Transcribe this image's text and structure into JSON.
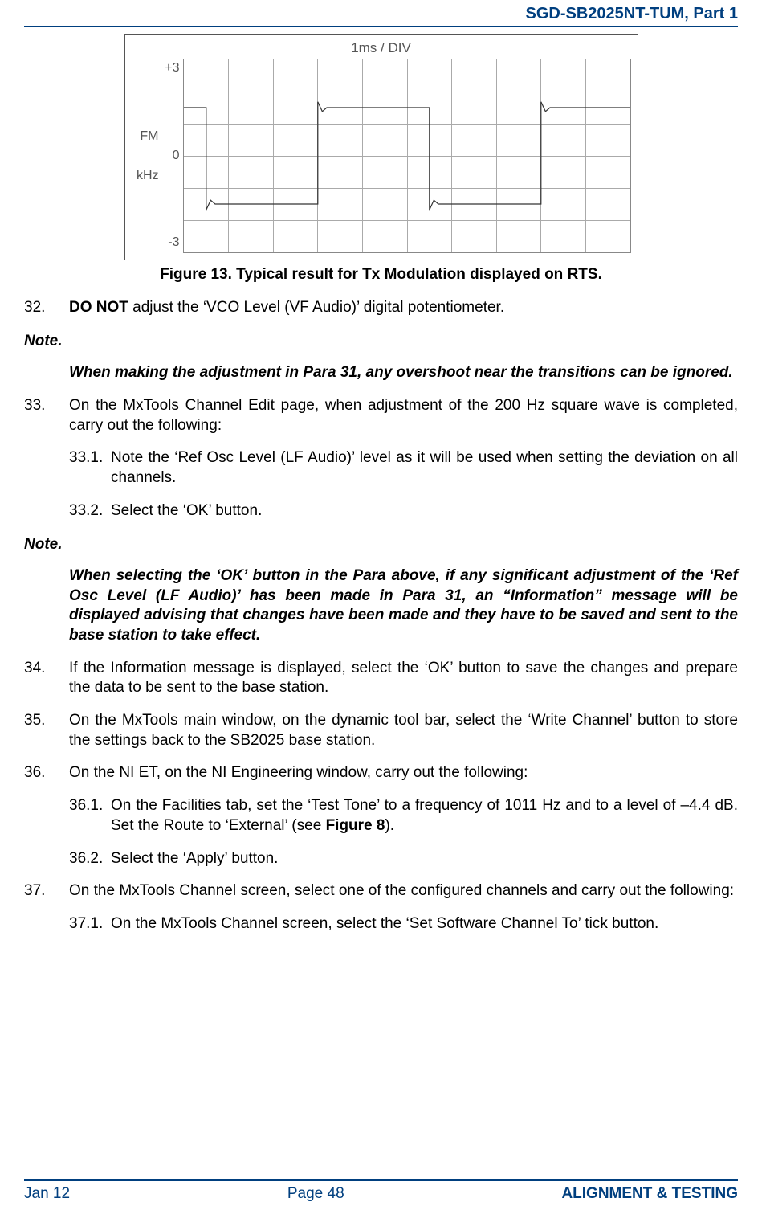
{
  "header": {
    "doc_id": "SGD-SB2025NT-TUM, Part 1"
  },
  "chart_data": {
    "type": "line",
    "title": "1ms / DIV",
    "xlabel": "",
    "ylabel_lines": [
      "FM",
      "kHz"
    ],
    "y_ticks": [
      "+3",
      "0",
      "-3"
    ],
    "ylim": [
      -3,
      3
    ],
    "x_divisions": 10,
    "note": "200 Hz square wave, approx -1.5 to +1.5 kHz deviation with slight overshoot at transitions"
  },
  "figure": {
    "caption": "Figure 13.  Typical result for Tx Modulation displayed on RTS."
  },
  "paras": {
    "p32": {
      "num": "32.",
      "lead": "DO NOT",
      "rest": " adjust the ‘VCO Level (VF Audio)’ digital potentiometer."
    },
    "note1": {
      "head": "Note.",
      "body": "When making the adjustment in Para 31, any overshoot near the transitions can be ignored."
    },
    "p33": {
      "num": "33.",
      "body": "On the MxTools Channel Edit page, when adjustment of the 200 Hz square wave is completed, carry out the following:",
      "s1": {
        "num": "33.1.",
        "body": "Note the ‘Ref Osc Level (LF Audio)’ level as it will be used when setting the deviation on all channels."
      },
      "s2": {
        "num": "33.2.",
        "body": "Select the ‘OK’ button."
      }
    },
    "note2": {
      "head": "Note.",
      "body": "When selecting the ‘OK’ button in the Para above, if any significant adjustment of the ‘Ref Osc Level (LF Audio)’ has been made in Para 31, an “Information” message will be displayed advising that changes have been made and they have to be saved and sent to the base station to take effect."
    },
    "p34": {
      "num": "34.",
      "body": "If the Information message is displayed, select the ‘OK’ button to save the changes and prepare the data to be sent to the base station."
    },
    "p35": {
      "num": "35.",
      "body": "On the MxTools main window, on the dynamic tool bar, select the ‘Write Channel’ button to store the settings back to the SB2025 base station."
    },
    "p36": {
      "num": "36.",
      "body": "On the NI ET, on the NI Engineering window, carry out the following:",
      "s1": {
        "num": "36.1.",
        "body_a": "On the Facilities tab, set the ‘Test Tone’ to a frequency of 1011 Hz and to a level of –4.4 dB.  Set the Route to ‘External’ (see ",
        "body_b": "Figure 8",
        "body_c": ")."
      },
      "s2": {
        "num": "36.2.",
        "body": "Select the ‘Apply’ button."
      }
    },
    "p37": {
      "num": "37.",
      "body": "On the MxTools Channel screen, select one of the configured channels and carry out the following:",
      "s1": {
        "num": "37.1.",
        "body": "On the MxTools Channel screen, select the ‘Set Software Channel To’ tick button."
      }
    }
  },
  "footer": {
    "left": "Jan 12",
    "center": "Page 48",
    "right": "ALIGNMENT & TESTING"
  }
}
